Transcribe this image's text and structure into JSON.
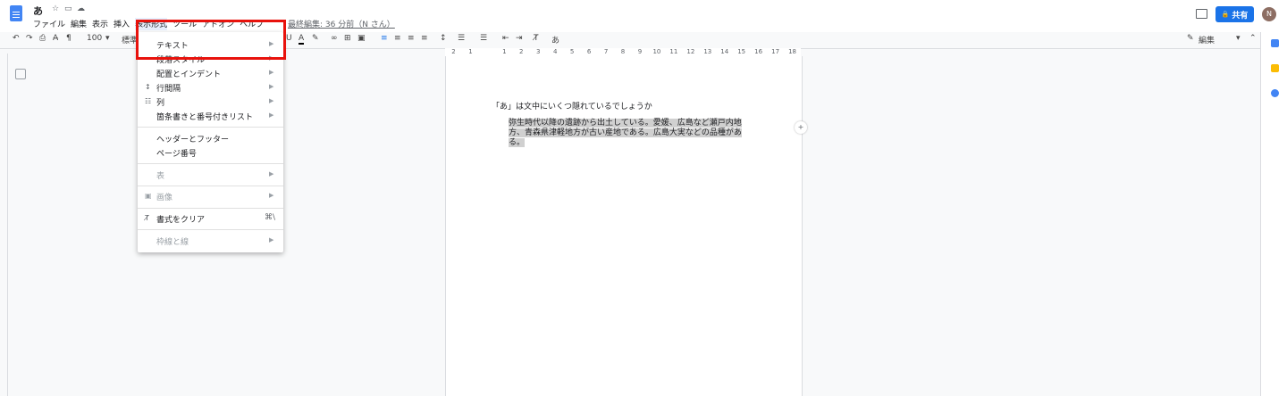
{
  "header": {
    "title": "あ",
    "menus": [
      "ファイル",
      "編集",
      "表示",
      "挿入",
      "表示形式",
      "ツール",
      "アドオン",
      "ヘルプ"
    ],
    "last_edit": "最終編集: 36 分前（N さん）",
    "share_label": "共有",
    "avatar_initial": "N"
  },
  "toolbar": {
    "zoom": "100",
    "style": "標準",
    "input_mode": "あ",
    "edit_mode": "編集"
  },
  "ruler": [
    "2",
    "1",
    "",
    "1",
    "2",
    "3",
    "4",
    "5",
    "6",
    "7",
    "8",
    "9",
    "10",
    "11",
    "12",
    "13",
    "14",
    "15",
    "16",
    "17",
    "18"
  ],
  "document": {
    "heading": "「あ」は文中にいくつ隠れているでしょうか",
    "body": "弥生時代以降の遺跡から出土している。愛媛、広島など瀬戸内地方、青森県津軽地方が古い産地である。広島大実などの品種がある。"
  },
  "format_menu": {
    "items": [
      {
        "label": "テキスト"
      },
      {
        "label": "段落スタイル"
      },
      {
        "label": "配置とインデント"
      },
      {
        "label": "行間隔"
      },
      {
        "label": "列"
      },
      {
        "label": "箇条書きと番号付きリスト"
      },
      {
        "label": "ヘッダーとフッター"
      },
      {
        "label": "ページ番号"
      },
      {
        "label": "表"
      },
      {
        "label": "画像"
      },
      {
        "label": "書式をクリア",
        "shortcut": "⌘\\"
      },
      {
        "label": "枠線と線"
      }
    ]
  },
  "colors": {
    "accent": "#1a73e8",
    "highlight": "#e8120c",
    "selection": "#d0d0d0"
  }
}
